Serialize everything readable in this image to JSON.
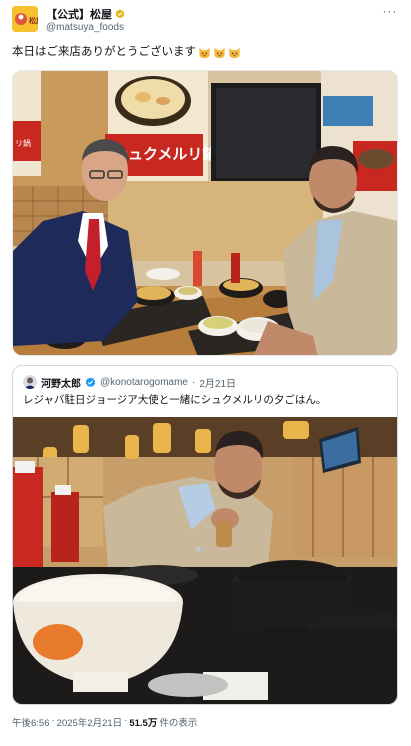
{
  "account": {
    "avatar_text": "松屋",
    "display_name": "【公式】松屋",
    "handle": "@matsuya_foods"
  },
  "tweet": {
    "text": "本日はご来店ありがとうございます",
    "emojis": [
      "cat-face-emoji",
      "cat-face-emoji",
      "cat-face-emoji"
    ]
  },
  "photo1": {
    "poster_text": "シュクメルリ鍋",
    "poster_side_text": "シュクメルリ鍋"
  },
  "quote": {
    "name": "河野太郎",
    "handle": "@konotarogomame",
    "date": "2月21日",
    "text": "レジャバ駐日ジョージア大使と一緒にシュクメルリの夕ごはん。"
  },
  "footer": {
    "time": "午後6:56",
    "date": "2025年2月21日",
    "views": "51.5万",
    "views_suffix": "件の表示"
  },
  "colors": {
    "verified_gold": "#e2b719",
    "verified_blue": "#1d9bf0",
    "text_secondary": "#536471"
  }
}
